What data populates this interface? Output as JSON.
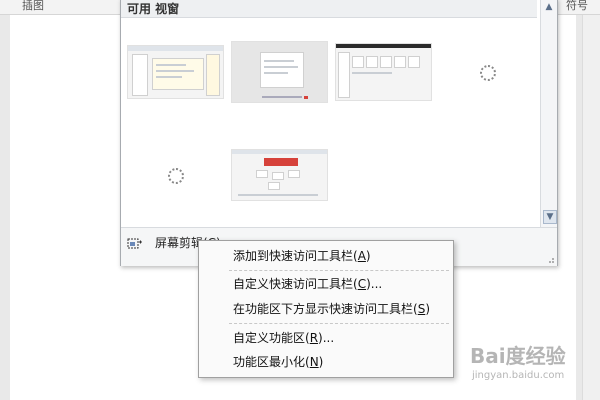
{
  "ribbon": {
    "left_label": "插图",
    "right_label": "符号"
  },
  "gallery": {
    "title": "可用 视窗",
    "footer_label": "屏幕剪辑(C)"
  },
  "context_menu": {
    "items": [
      {
        "text": "添加到快速访问工具栏(",
        "key": "A",
        "tail": ")"
      },
      {
        "text": "自定义快速访问工具栏(",
        "key": "C",
        "tail": ")..."
      },
      {
        "text": "在功能区下方显示快速访问工具栏(",
        "key": "S",
        "tail": ")"
      },
      {
        "text": "自定义功能区(",
        "key": "R",
        "tail": ")..."
      },
      {
        "text": "功能区最小化(",
        "key": "N",
        "tail": ")"
      }
    ]
  },
  "watermark": {
    "logo": "Bai度经验",
    "sub": "jingyan.baidu.com"
  },
  "colors": {
    "menu_bg": "#fafafa",
    "gallery_border": "#a7abb0",
    "accent_red": "#d6423b"
  }
}
